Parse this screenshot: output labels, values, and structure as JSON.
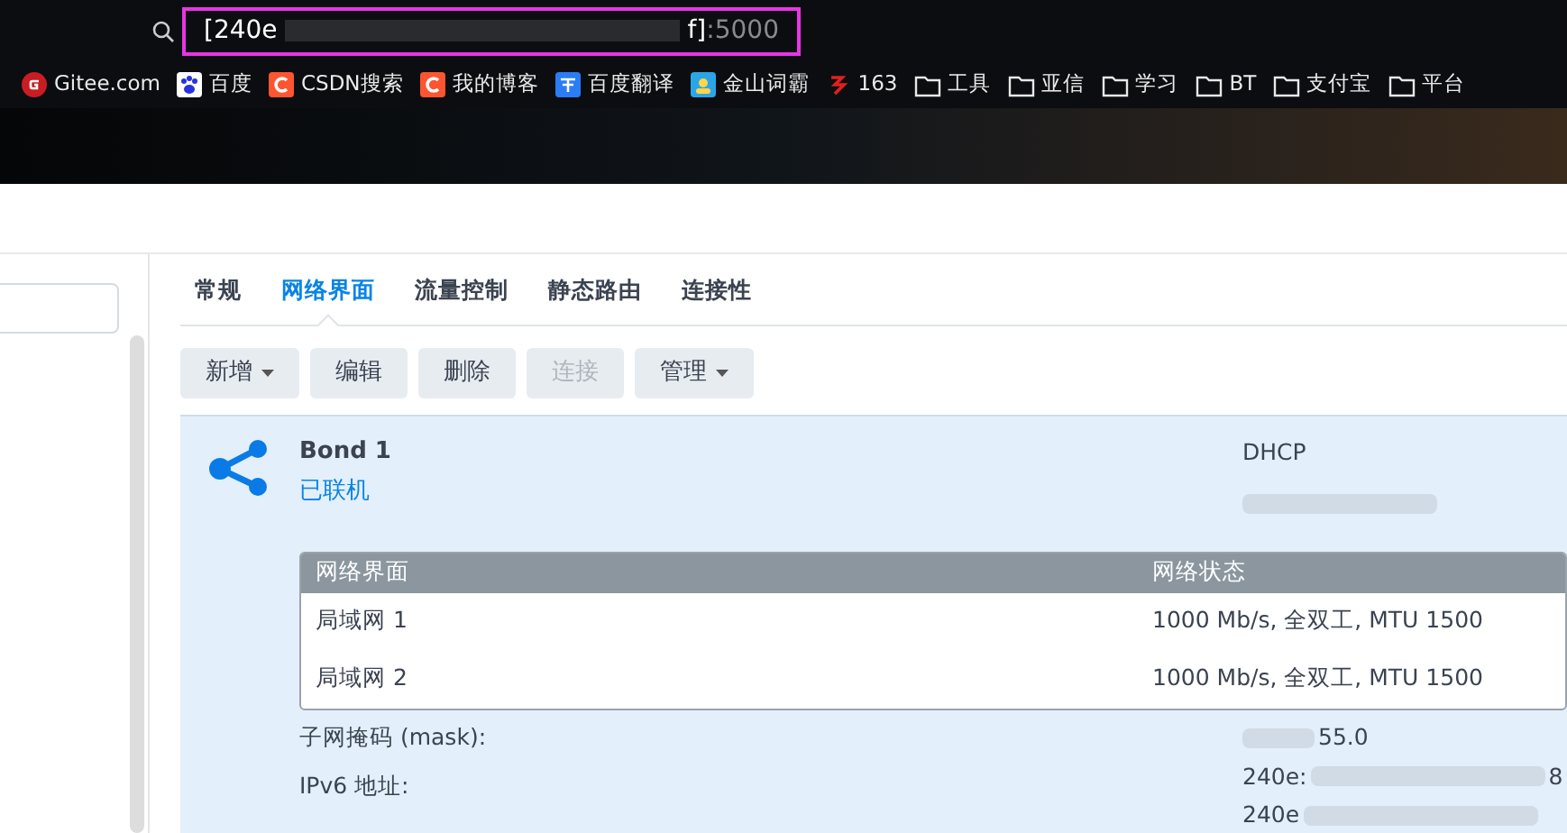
{
  "address_bar": {
    "host_start": "[240e",
    "host_end": "f]",
    "port": ":5000"
  },
  "bookmarks": [
    {
      "label": "Gitee.com",
      "kind": "gitee"
    },
    {
      "label": "百度",
      "kind": "baidu"
    },
    {
      "label": "CSDN搜索",
      "kind": "csdn"
    },
    {
      "label": "我的博客",
      "kind": "csdn"
    },
    {
      "label": "百度翻译",
      "kind": "translate"
    },
    {
      "label": "金山词霸",
      "kind": "ciba"
    },
    {
      "label": "163",
      "kind": "netease"
    },
    {
      "label": "工具",
      "kind": "folder"
    },
    {
      "label": "亚信",
      "kind": "folder"
    },
    {
      "label": "学习",
      "kind": "folder"
    },
    {
      "label": "BT",
      "kind": "folder"
    },
    {
      "label": "支付宝",
      "kind": "folder"
    },
    {
      "label": "平台",
      "kind": "folder"
    }
  ],
  "tabs": [
    {
      "label": "常规",
      "selected": false
    },
    {
      "label": "网络界面",
      "selected": true
    },
    {
      "label": "流量控制",
      "selected": false
    },
    {
      "label": "静态路由",
      "selected": false
    },
    {
      "label": "连接性",
      "selected": false
    }
  ],
  "toolbar": [
    {
      "label": "新增",
      "dropdown": true,
      "disabled": false
    },
    {
      "label": "编辑",
      "dropdown": false,
      "disabled": false
    },
    {
      "label": "删除",
      "dropdown": false,
      "disabled": false
    },
    {
      "label": "连接",
      "dropdown": false,
      "disabled": true
    },
    {
      "label": "管理",
      "dropdown": true,
      "disabled": false
    }
  ],
  "interface": {
    "name": "Bond 1",
    "status": "已联机",
    "mode": "DHCP",
    "table": {
      "columns": [
        "网络界面",
        "网络状态"
      ],
      "rows": [
        [
          "局域网 1",
          "1000 Mb/s, 全双工, MTU 1500"
        ],
        [
          "局域网 2",
          "1000 Mb/s, 全双工, MTU 1500"
        ]
      ]
    },
    "mask_label": "子网掩码 (mask):",
    "mask_value_end": "55.0",
    "ipv6_label": "IPv6 地址:",
    "ipv6_lines": [
      {
        "start": "240e:",
        "end": "8"
      },
      {
        "start": "240e"
      }
    ]
  }
}
